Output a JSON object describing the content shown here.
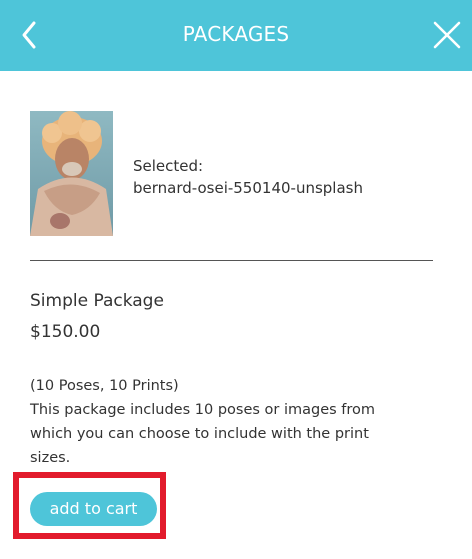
{
  "header": {
    "title": "PACKAGES",
    "back_icon": "chevron-left-icon",
    "close_icon": "close-icon",
    "color": "#4ec5d9"
  },
  "selection": {
    "label": "Selected:",
    "filename": "bernard-osei-550140-unsplash"
  },
  "package": {
    "name": "Simple Package",
    "price": "$150.00",
    "summary": "(10 Poses, 10 Prints)",
    "description": "This package includes 10 poses or images from which you can choose to include with the print sizes."
  },
  "actions": {
    "add_to_cart": "add to cart"
  },
  "colors": {
    "accent": "#4ec5d9",
    "highlight": "#e21b2c"
  }
}
